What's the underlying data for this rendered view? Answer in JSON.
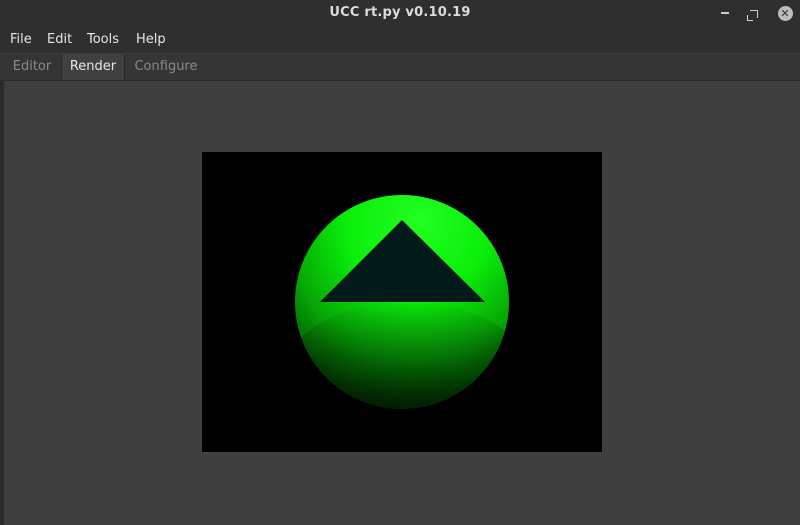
{
  "window": {
    "title": "UCC rt.py v0.10.19",
    "minimize_icon": "minimize-icon",
    "maximize_icon": "maximize-icon",
    "close_icon": "close-icon"
  },
  "menu": {
    "items": [
      "File",
      "Edit",
      "Tools",
      "Help"
    ]
  },
  "tabs": {
    "items": [
      "Editor",
      "Render",
      "Configure"
    ],
    "active": "Render"
  },
  "render": {
    "background_color": "#000000",
    "sphere_color": "#00ff00",
    "triangle_color": "#021a1a"
  }
}
